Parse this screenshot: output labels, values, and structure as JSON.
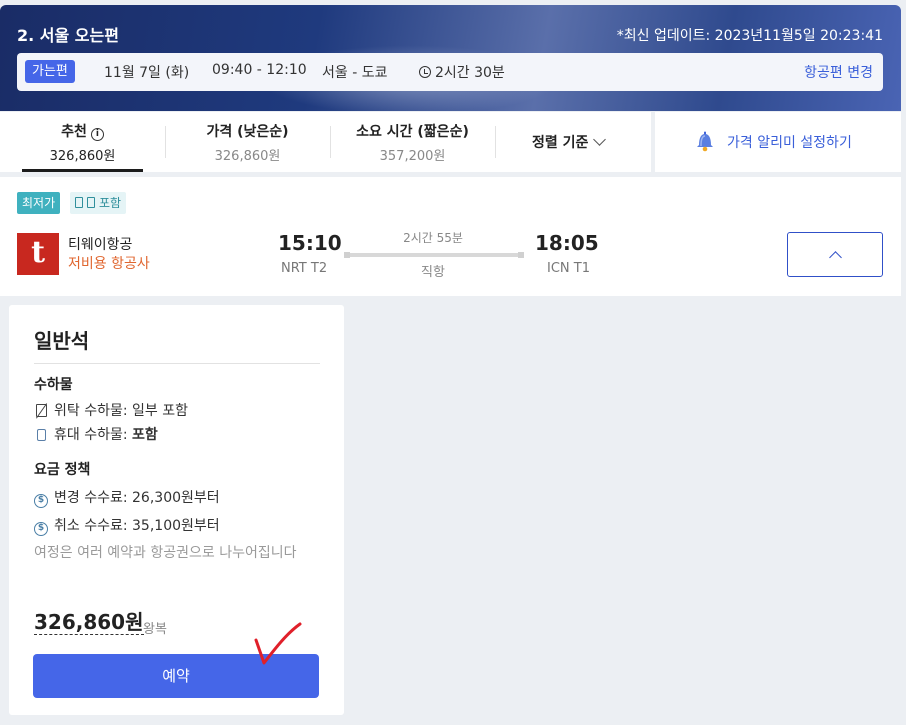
{
  "header": {
    "title": "2. 서울 오는편",
    "update": "*최신 업데이트: 2023년11월5일 20:23:41",
    "trip": {
      "badge": "가는편",
      "date": "11월 7일 (화)",
      "time": "09:40 - 12:10",
      "route": "서울 - 도쿄",
      "duration": "2시간 30분",
      "change_link": "항공편 변경"
    }
  },
  "sort": {
    "tabs": [
      {
        "label": "추천",
        "value": "326,860원"
      },
      {
        "label": "가격 (낮은순)",
        "value": "326,860원"
      },
      {
        "label": "소요 시간 (짧은순)",
        "value": "357,200원"
      }
    ],
    "dropdown": "정렬 기준",
    "alert": "가격 알리미 설정하기"
  },
  "flight": {
    "badge_lowest": "최저가",
    "badge_bag": "포함",
    "logo_letter": "t",
    "airline": "티웨이항공",
    "airline_type": "저비용 항공사",
    "depart_time": "15:10",
    "depart_airport": "NRT T2",
    "duration": "2시간 55분",
    "stops": "직항",
    "arrive_time": "18:05",
    "arrive_airport": "ICN T1"
  },
  "fare": {
    "class": "일반석",
    "baggage_heading": "수하물",
    "checked_bag": "위탁 수하물: 일부 포함",
    "carry_on_label": "휴대 수하물: ",
    "carry_on_value": "포함",
    "policy_heading": "요금 정책",
    "change_fee": "변경 수수료: 26,300원부터",
    "cancel_fee": "취소 수수료: 35,100원부터",
    "note": "여정은 여러 예약과 항공권으로 나누어집니다",
    "price": "326,860원",
    "price_type": "왕복",
    "book_button": "예약"
  },
  "colors": {
    "accent": "#4566e8",
    "lowest_badge": "#3fb1bf",
    "airline_logo": "#c8281f",
    "lcc_text": "#e0662f",
    "annotation": "#e0202a"
  }
}
